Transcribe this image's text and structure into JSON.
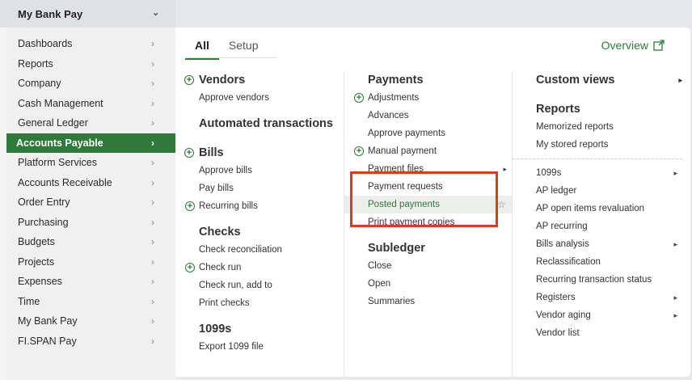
{
  "topbar": {
    "title": "My Bank Pay"
  },
  "sidebar": {
    "items": [
      {
        "label": "Dashboards"
      },
      {
        "label": "Reports"
      },
      {
        "label": "Company"
      },
      {
        "label": "Cash Management"
      },
      {
        "label": "General Ledger"
      },
      {
        "label": "Accounts Payable",
        "active": true
      },
      {
        "label": "Platform Services"
      },
      {
        "label": "Accounts Receivable"
      },
      {
        "label": "Order Entry"
      },
      {
        "label": "Purchasing"
      },
      {
        "label": "Budgets"
      },
      {
        "label": "Projects"
      },
      {
        "label": "Expenses"
      },
      {
        "label": "Time"
      },
      {
        "label": "My Bank Pay"
      },
      {
        "label": "FI.SPAN Pay"
      }
    ]
  },
  "tabs": {
    "all": "All",
    "setup": "Setup"
  },
  "overview": {
    "label": "Overview"
  },
  "col1": {
    "vendors": "Vendors",
    "approve_vendors": "Approve vendors",
    "automated": "Automated transactions",
    "bills": "Bills",
    "approve_bills": "Approve bills",
    "pay_bills": "Pay bills",
    "recurring_bills": "Recurring bills",
    "checks": "Checks",
    "check_reconciliation": "Check reconciliation",
    "check_run": "Check run",
    "check_run_add": "Check run, add to",
    "print_checks": "Print checks",
    "h1099s": "1099s",
    "export_1099": "Export 1099 file"
  },
  "col2": {
    "payments": "Payments",
    "adjustments": "Adjustments",
    "advances": "Advances",
    "approve_payments": "Approve payments",
    "manual_payment": "Manual payment",
    "payment_files": "Payment files",
    "payment_requests": "Payment requests",
    "posted_payments": "Posted payments",
    "print_payment_copies": "Print payment copies",
    "subledger": "Subledger",
    "close": "Close",
    "open": "Open",
    "summaries": "Summaries"
  },
  "col3": {
    "custom_views": "Custom views",
    "reports": "Reports",
    "memorized_reports": "Memorized reports",
    "my_stored_reports": "My stored reports",
    "r1099s": "1099s",
    "ap_ledger": "AP ledger",
    "ap_open_items": "AP open items revaluation",
    "ap_recurring": "AP recurring",
    "bills_analysis": "Bills analysis",
    "reclassification": "Reclassification",
    "recurring_status": "Recurring transaction status",
    "registers": "Registers",
    "vendor_aging": "Vendor aging",
    "vendor_list": "Vendor list"
  },
  "colors": {
    "accent": "#2f7a3b",
    "highlight_box": "#e03a1e"
  },
  "icons": [
    "chevron-down-icon",
    "chevron-right-icon",
    "plus-circle-icon",
    "external-link-icon"
  ]
}
